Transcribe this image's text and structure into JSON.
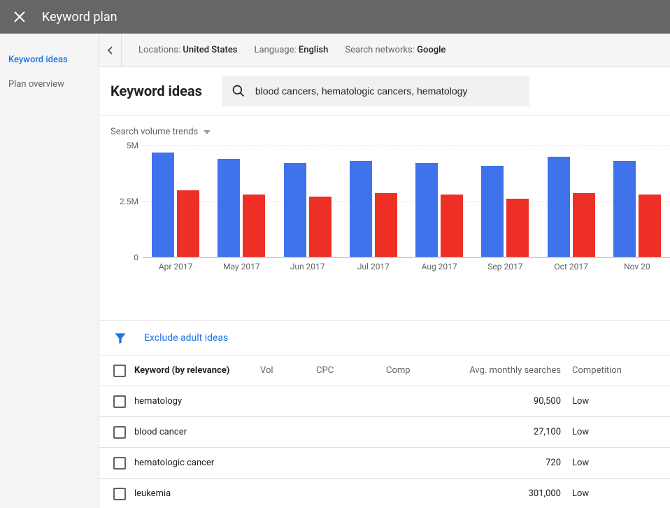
{
  "header": {
    "title": "Keyword plan"
  },
  "sidebar": {
    "items": [
      {
        "label": "Keyword ideas",
        "active": true
      },
      {
        "label": "Plan overview",
        "active": false
      }
    ]
  },
  "filters": [
    {
      "label": "Locations:",
      "value": "United States"
    },
    {
      "label": "Language:",
      "value": "English"
    },
    {
      "label": "Search networks:",
      "value": "Google"
    }
  ],
  "page_title": "Keyword ideas",
  "search": {
    "value": "blood cancers, hematologic cancers, hematology"
  },
  "trends_label": "Search volume trends",
  "chart_data": {
    "type": "bar",
    "title": "",
    "xlabel": "",
    "ylabel": "",
    "ylim": [
      0,
      5000000
    ],
    "yaxis_ticks": [
      {
        "label": "5M",
        "value": 5000000
      },
      {
        "label": "2.5M",
        "value": 2500000
      },
      {
        "label": "0",
        "value": 0
      }
    ],
    "categories": [
      "Apr 2017",
      "May 2017",
      "Jun 2017",
      "Jul 2017",
      "Aug 2017",
      "Sep 2017",
      "Oct 2017",
      "Nov 20"
    ],
    "series": [
      {
        "name": "blue",
        "color": "#4072ec",
        "values": [
          4700000,
          4400000,
          4200000,
          4300000,
          4200000,
          4100000,
          4500000,
          4300000
        ]
      },
      {
        "name": "red",
        "color": "#ee2f25",
        "values": [
          3000000,
          2800000,
          2700000,
          2850000,
          2800000,
          2600000,
          2850000,
          2800000
        ]
      }
    ]
  },
  "exclude_label": "Exclude adult ideas",
  "columns": {
    "keyword": "Keyword (by relevance)",
    "vol": "Vol",
    "cpc": "CPC",
    "comp": "Comp",
    "avg": "Avg. monthly searches",
    "competition": "Competition"
  },
  "rows": [
    {
      "keyword": "hematology",
      "avg": "90,500",
      "competition": "Low"
    },
    {
      "keyword": "blood cancer",
      "avg": "27,100",
      "competition": "Low"
    },
    {
      "keyword": "hematologic cancer",
      "avg": "720",
      "competition": "Low"
    },
    {
      "keyword": "leukemia",
      "avg": "301,000",
      "competition": "Low"
    }
  ]
}
